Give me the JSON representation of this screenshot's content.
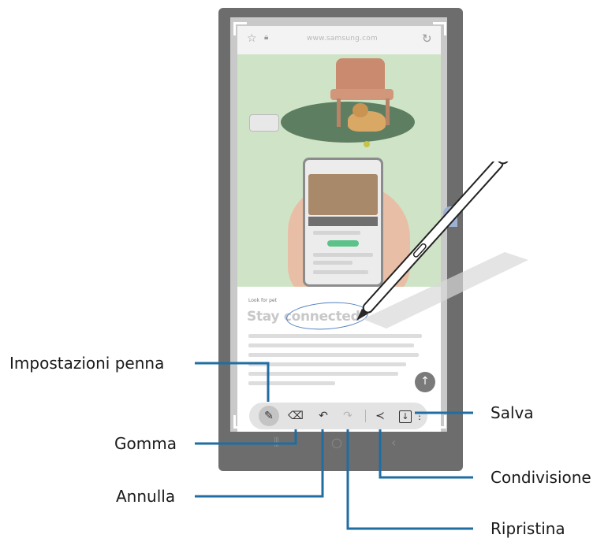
{
  "browser": {
    "url": "www.samsung.com",
    "bookmark_icon": "star-outline-icon",
    "lock_icon": "lock-icon",
    "reload_icon": "reload-icon"
  },
  "article": {
    "kicker": "Look for pet",
    "title": "Stay connected"
  },
  "toolbar": {
    "buttons": [
      {
        "icon": "pen-icon",
        "state": "active"
      },
      {
        "icon": "eraser-icon",
        "state": "enabled"
      },
      {
        "icon": "undo-icon",
        "state": "enabled"
      },
      {
        "icon": "redo-icon",
        "state": "disabled"
      },
      {
        "icon": "share-icon",
        "state": "enabled"
      },
      {
        "icon": "save-icon",
        "state": "enabled"
      }
    ]
  },
  "labels": {
    "pen_settings": "Impostazioni penna",
    "eraser": "Gomma",
    "undo": "Annulla",
    "save": "Salva",
    "share": "Condivisione",
    "redo": "Ripristina"
  },
  "colors": {
    "callout_line": "#1f6da3",
    "annotation_circle": "#4f7fc0"
  }
}
